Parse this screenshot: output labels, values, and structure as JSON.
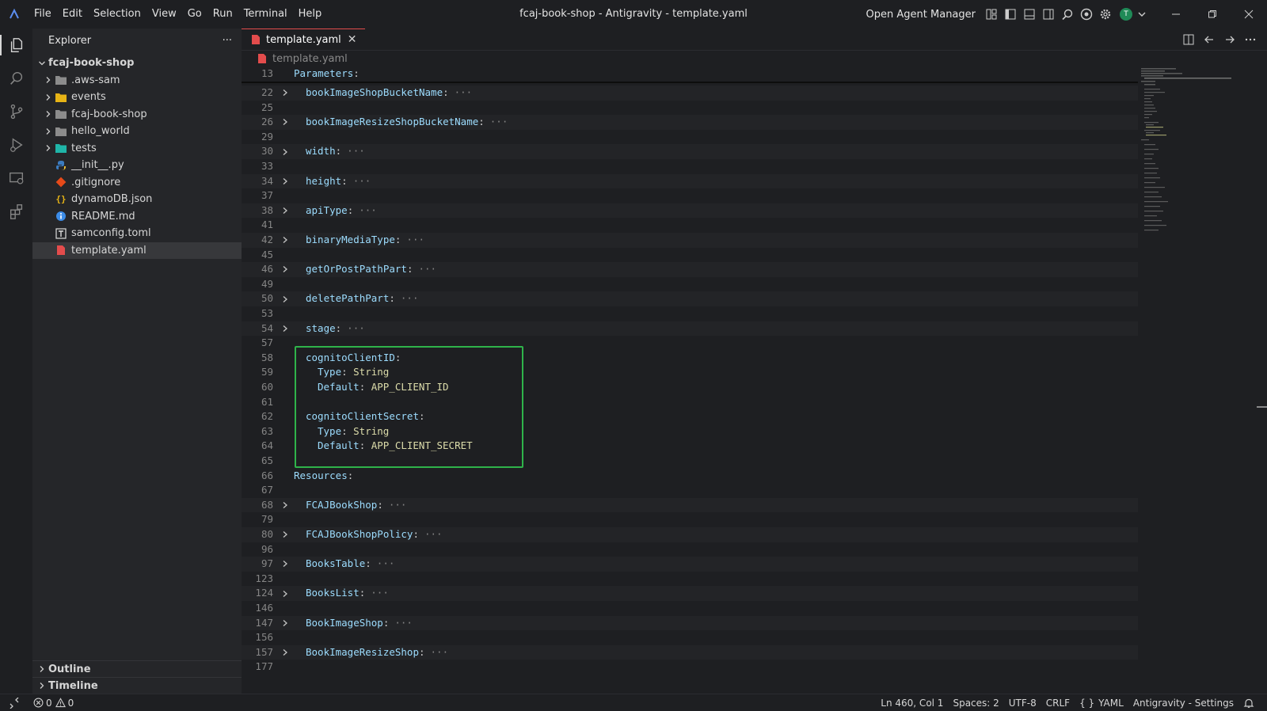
{
  "titlebar": {
    "menu": [
      "File",
      "Edit",
      "Selection",
      "View",
      "Go",
      "Run",
      "Terminal",
      "Help"
    ],
    "window_title": "fcaj-book-shop - Antigravity - template.yaml",
    "agent_manager_label": "Open Agent Manager",
    "avatar_initial": "T"
  },
  "sidebar": {
    "title": "Explorer",
    "more": "···",
    "root": "fcaj-book-shop",
    "items": [
      {
        "label": ".aws-sam",
        "kind": "folder"
      },
      {
        "label": "events",
        "kind": "folder"
      },
      {
        "label": "fcaj-book-shop",
        "kind": "folder"
      },
      {
        "label": "hello_world",
        "kind": "folder"
      },
      {
        "label": "tests",
        "kind": "folder"
      },
      {
        "label": "__init__.py",
        "kind": "file"
      },
      {
        "label": ".gitignore",
        "kind": "file"
      },
      {
        "label": "dynamoDB.json",
        "kind": "file"
      },
      {
        "label": "README.md",
        "kind": "file"
      },
      {
        "label": "samconfig.toml",
        "kind": "file"
      },
      {
        "label": "template.yaml",
        "kind": "file"
      }
    ],
    "outline_label": "Outline",
    "timeline_label": "Timeline"
  },
  "editor": {
    "tab_label": "template.yaml",
    "tab_close": "✕",
    "breadcrumb": "template.yaml",
    "lines": [
      {
        "n": "13",
        "key": "Parameters",
        "indent": 0,
        "folded": false
      },
      {
        "n": "22",
        "key": "bookImageShopBucketName",
        "indent": 1,
        "folded": true
      },
      {
        "n": "25",
        "key": "",
        "indent": 0,
        "folded": false
      },
      {
        "n": "26",
        "key": "bookImageResizeShopBucketName",
        "indent": 1,
        "folded": true
      },
      {
        "n": "29",
        "key": "",
        "indent": 0,
        "folded": false
      },
      {
        "n": "30",
        "key": "width",
        "indent": 1,
        "folded": true
      },
      {
        "n": "33",
        "key": "",
        "indent": 0,
        "folded": false
      },
      {
        "n": "34",
        "key": "height",
        "indent": 1,
        "folded": true
      },
      {
        "n": "37",
        "key": "",
        "indent": 0,
        "folded": false
      },
      {
        "n": "38",
        "key": "apiType",
        "indent": 1,
        "folded": true
      },
      {
        "n": "41",
        "key": "",
        "indent": 0,
        "folded": false
      },
      {
        "n": "42",
        "key": "binaryMediaType",
        "indent": 1,
        "folded": true
      },
      {
        "n": "45",
        "key": "",
        "indent": 0,
        "folded": false
      },
      {
        "n": "46",
        "key": "getOrPostPathPart",
        "indent": 1,
        "folded": true
      },
      {
        "n": "49",
        "key": "",
        "indent": 0,
        "folded": false
      },
      {
        "n": "50",
        "key": "deletePathPart",
        "indent": 1,
        "folded": true
      },
      {
        "n": "53",
        "key": "",
        "indent": 0,
        "folded": false
      },
      {
        "n": "54",
        "key": "stage",
        "indent": 1,
        "folded": true
      },
      {
        "n": "57",
        "key": "",
        "indent": 0,
        "folded": false
      },
      {
        "n": "58",
        "key": "cognitoClientID",
        "indent": 1,
        "folded": false
      },
      {
        "n": "59",
        "key": "Type",
        "value": "String",
        "indent": 2,
        "folded": false
      },
      {
        "n": "60",
        "key": "Default",
        "value": "APP_CLIENT_ID",
        "indent": 2,
        "folded": false
      },
      {
        "n": "61",
        "key": "",
        "indent": 0,
        "folded": false
      },
      {
        "n": "62",
        "key": "cognitoClientSecret",
        "indent": 1,
        "folded": false
      },
      {
        "n": "63",
        "key": "Type",
        "value": "String",
        "indent": 2,
        "folded": false
      },
      {
        "n": "64",
        "key": "Default",
        "value": "APP_CLIENT_SECRET",
        "indent": 2,
        "folded": false
      },
      {
        "n": "65",
        "key": "",
        "indent": 0,
        "folded": false
      },
      {
        "n": "66",
        "key": "Resources",
        "indent": 0,
        "folded": false
      },
      {
        "n": "67",
        "key": "",
        "indent": 0,
        "folded": false
      },
      {
        "n": "68",
        "key": "FCAJBookShop",
        "indent": 1,
        "folded": true
      },
      {
        "n": "79",
        "key": "",
        "indent": 0,
        "folded": false
      },
      {
        "n": "80",
        "key": "FCAJBookShopPolicy",
        "indent": 1,
        "folded": true
      },
      {
        "n": "96",
        "key": "",
        "indent": 0,
        "folded": false
      },
      {
        "n": "97",
        "key": "BooksTable",
        "indent": 1,
        "folded": true
      },
      {
        "n": "123",
        "key": "",
        "indent": 0,
        "folded": false
      },
      {
        "n": "124",
        "key": "BooksList",
        "indent": 1,
        "folded": true
      },
      {
        "n": "146",
        "key": "",
        "indent": 0,
        "folded": false
      },
      {
        "n": "147",
        "key": "BookImageShop",
        "indent": 1,
        "folded": true
      },
      {
        "n": "156",
        "key": "",
        "indent": 0,
        "folded": false
      },
      {
        "n": "157",
        "key": "BookImageResizeShop",
        "indent": 1,
        "folded": true
      },
      {
        "n": "177",
        "key": "",
        "indent": 0,
        "folded": false
      }
    ]
  },
  "statusbar": {
    "errors": "0",
    "warnings": "0",
    "cursor": "Ln 460, Col 1",
    "spaces": "Spaces: 2",
    "encoding": "UTF-8",
    "eol": "CRLF",
    "language": "YAML",
    "language_icon": "{ }",
    "settings": "Antigravity - Settings"
  },
  "colors": {
    "highlight_box": "#2fb34a",
    "tab_accent": "#e34c4c"
  }
}
